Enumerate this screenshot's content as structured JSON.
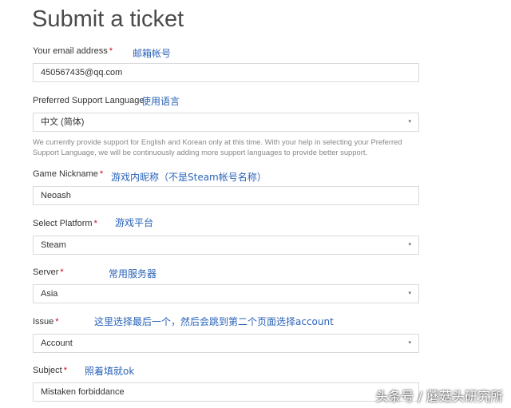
{
  "page": {
    "title": "Submit a ticket"
  },
  "fields": {
    "email": {
      "label": "Your email address",
      "required": "*",
      "value": "450567435@qq.com",
      "annotation": "邮箱帐号"
    },
    "language": {
      "label": "Preferred Support Language",
      "value": "中文 (简体)",
      "annotation": "使用语言",
      "help": "We currently provide support for English and Korean only at this time. With your help in selecting your Preferred Support Language, we will be continuously adding more support languages to provide better support."
    },
    "nickname": {
      "label": "Game Nickname",
      "required": "*",
      "value": "Neoash",
      "annotation": "游戏内昵称（不是Steam帐号名称）"
    },
    "platform": {
      "label": "Select Platform",
      "required": "*",
      "value": "Steam",
      "annotation": "游戏平台"
    },
    "server": {
      "label": "Server",
      "required": "*",
      "value": "Asia",
      "annotation": "常用服务器"
    },
    "issue": {
      "label": "Issue",
      "required": "*",
      "value": "Account",
      "annotation": "这里选择最后一个，然后会跳到第二个页面选择account"
    },
    "subject": {
      "label": "Subject",
      "required": "*",
      "value": "Mistaken forbiddance",
      "annotation": "照着填就ok"
    }
  },
  "icons": {
    "select_caret": "▾"
  },
  "colors": {
    "required": "#d0021b",
    "annotation": "#2a63b8"
  },
  "watermark": {
    "text": "头条号 / 蘑菇头研究所"
  }
}
